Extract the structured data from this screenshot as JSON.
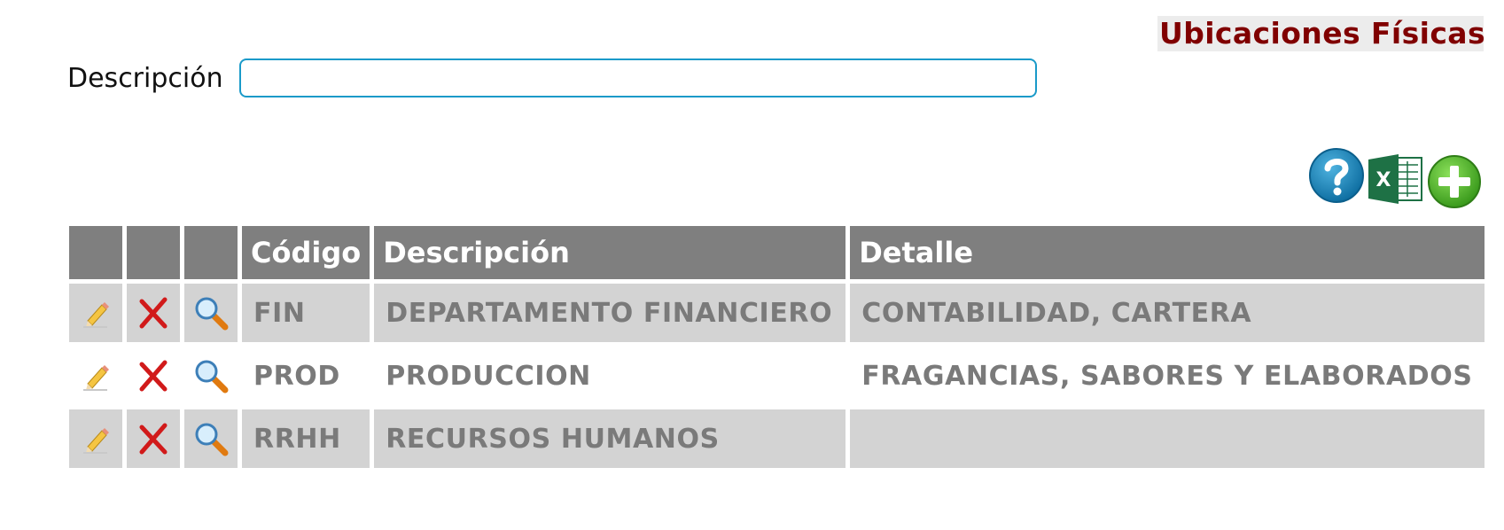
{
  "header": {
    "title": "Ubicaciones Físicas"
  },
  "filter": {
    "label": "Descripción",
    "value": "",
    "placeholder": ""
  },
  "toolbar": {
    "help_icon": "help-icon",
    "excel_icon": "excel-export-icon",
    "add_icon": "add-icon",
    "excel_letter": "X"
  },
  "table": {
    "columns": [
      "",
      "",
      "",
      "Código",
      "Descripción",
      "Detalle"
    ],
    "rows": [
      {
        "code": "FIN",
        "description": "DEPARTAMENTO FINANCIERO",
        "detail": "CONTABILIDAD, CARTERA"
      },
      {
        "code": "PROD",
        "description": "PRODUCCION",
        "detail": "FRAGANCIAS, SABORES Y ELABORADOS"
      },
      {
        "code": "RRHH",
        "description": "RECURSOS HUMANOS",
        "detail": ""
      }
    ],
    "row_actions": [
      "edit-pencil-icon",
      "delete-x-icon",
      "view-magnifier-icon"
    ]
  },
  "colors": {
    "title": "#800000",
    "header_bg": "#7f7f7f",
    "row_alt_bg": "#d3d3d3",
    "cell_text": "#7a7a7a",
    "input_border": "#1a9ac9"
  }
}
